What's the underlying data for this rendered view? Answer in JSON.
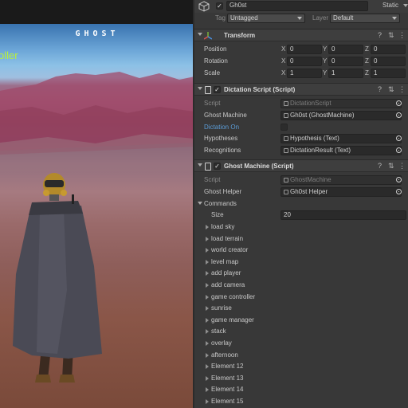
{
  "game": {
    "title": "GHOST",
    "overlay_text": "oller"
  },
  "header": {
    "object_name": "Gh0st",
    "static_label": "Static",
    "tag_label": "Tag",
    "tag_value": "Untagged",
    "layer_label": "Layer",
    "layer_value": "Default"
  },
  "transform": {
    "title": "Transform",
    "rows": [
      {
        "label": "Position",
        "x": "0",
        "y": "0",
        "z": "0"
      },
      {
        "label": "Rotation",
        "x": "0",
        "y": "0",
        "z": "0"
      },
      {
        "label": "Scale",
        "x": "1",
        "y": "1",
        "z": "1"
      }
    ],
    "axis_labels": [
      "X",
      "Y",
      "Z"
    ]
  },
  "dictation": {
    "title": "Dictation Script (Script)",
    "script_label": "Script",
    "script_value": "DictationScript",
    "ghost_machine_label": "Ghost Machine",
    "ghost_machine_value": "Gh0st (GhostMachine)",
    "dictation_on_label": "Dictation On",
    "hypotheses_label": "Hypotheses",
    "hypotheses_value": "Hypothesis (Text)",
    "recognitions_label": "Recognitions",
    "recognitions_value": "DictationResult (Text)"
  },
  "ghost_machine": {
    "title": "Ghost Machine (Script)",
    "script_label": "Script",
    "script_value": "GhostMachine",
    "helper_label": "Ghost Helper",
    "helper_value": "Gh0st Helper",
    "commands_label": "Commands",
    "size_label": "Size",
    "size_value": "20",
    "commands": [
      "load sky",
      "load terrain",
      "world creator",
      "level map",
      "add player",
      "add camera",
      "game controller",
      "sunrise",
      "game manager",
      "stack",
      "overlay",
      "afternoon",
      "Element 12",
      "Element 13",
      "Element 14",
      "Element 15"
    ]
  },
  "colors": {
    "inspector_bg": "#383838",
    "field_bg": "#2a2a2a",
    "link_blue": "#5b9bd5",
    "overlay_green": "#b9f03a"
  }
}
